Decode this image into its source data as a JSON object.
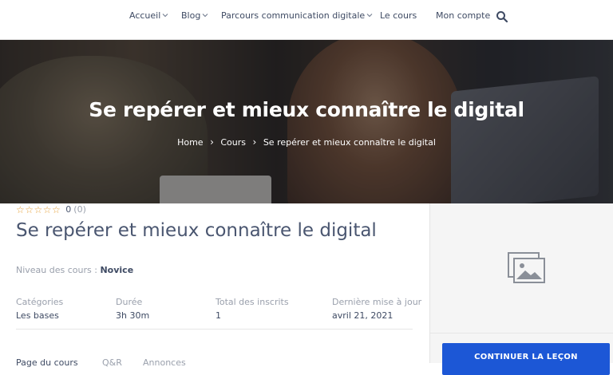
{
  "nav": {
    "items": [
      {
        "label": "Accueil",
        "dropdown": true
      },
      {
        "label": "Blog",
        "dropdown": true
      },
      {
        "label": "Parcours communication digitale",
        "dropdown": true
      },
      {
        "label": "Le cours",
        "dropdown": false
      },
      {
        "label": "Mon compte",
        "dropdown": false
      }
    ],
    "search_icon": "search-icon"
  },
  "hero": {
    "title": "Se repérer et mieux connaître le digital",
    "breadcrumb": [
      "Home",
      "Cours",
      "Se repérer et mieux connaître le digital"
    ],
    "separator": "›"
  },
  "course": {
    "rating": {
      "stars": "☆☆☆☆☆",
      "value": "0",
      "count": "(0)"
    },
    "title": "Se repérer et mieux connaître le digital",
    "level_label": "Niveau des cours :",
    "level_value": "Novice",
    "meta": [
      {
        "label": "Catégories",
        "value": "Les bases"
      },
      {
        "label": "Durée",
        "value": "3h 30m"
      },
      {
        "label": "Total des inscrits",
        "value": "1"
      },
      {
        "label": "Dernière mise à jour",
        "value": "avril 21, 2021"
      }
    ],
    "tabs": [
      "Page du cours",
      "Q&R",
      "Annonces"
    ]
  },
  "sidebar": {
    "image_icon": "image-placeholder-icon",
    "continue_label": "CONTINUER LA LEÇON"
  },
  "colors": {
    "accent": "#1c57d6",
    "text": "#4a5670",
    "muted": "#9aa0ac",
    "star": "#e6a23c"
  }
}
